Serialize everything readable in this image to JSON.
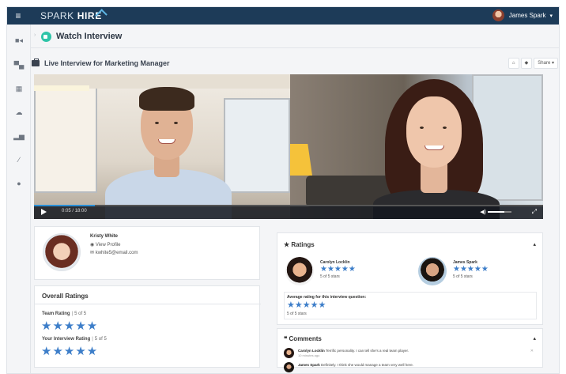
{
  "app": {
    "logo_text_light": "SPARK",
    "logo_text_bold": "HIRE",
    "user_name": "James Spark",
    "brand_colors": {
      "topbar": "#1d3b58",
      "accent": "#2ec4a8",
      "star": "#3d7ec9"
    }
  },
  "sidebar": {
    "icons": [
      "video-icon",
      "briefcase-icon",
      "calendar-icon",
      "cloud-icon",
      "bar-chart-icon",
      "wand-icon",
      "help-icon"
    ]
  },
  "header": {
    "title": "Watch Interview"
  },
  "interview": {
    "title": "Live Interview for Marketing Manager",
    "share_label": "Share",
    "player": {
      "time": "0:05 / 18:00",
      "progress": 0.12,
      "volume": 0.7
    }
  },
  "candidate": {
    "name": "Kristy White",
    "view_profile": "View Profile",
    "email": "kwhite5@email.com"
  },
  "overall_ratings": {
    "title": "Overall Ratings",
    "team_label": "Team Rating",
    "team_sub": "5 of 5",
    "team_stars": "★★★★★",
    "your_label": "Your Interview Rating",
    "your_sub": "5 of 5",
    "your_stars": "★★★★★"
  },
  "ratings": {
    "title": "Ratings",
    "raters": [
      {
        "name": "Carolyn Locklin",
        "stars": "★★★★★",
        "sub": "5 of 5 stars"
      },
      {
        "name": "James Spark",
        "stars": "★★★★★",
        "sub": "5 of 5 stars"
      }
    ],
    "avg_label": "Average rating for this interview question:",
    "avg_stars": "★★★★★",
    "avg_sub": "5 of 5 stars"
  },
  "comments": {
    "title": "Comments",
    "items": [
      {
        "author": "Carolyn Locklin",
        "text": "Terrific personality. I can tell she's a real team player.",
        "time": "10 minutes ago"
      },
      {
        "author": "James Spark",
        "text": "Definitely. I think she would manage a team very well here.",
        "time": ""
      }
    ]
  }
}
